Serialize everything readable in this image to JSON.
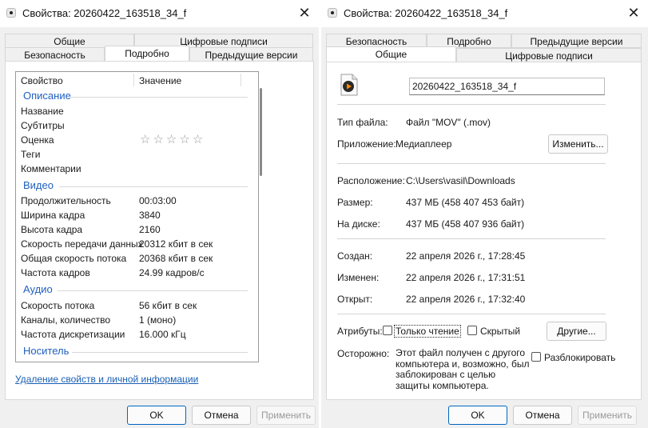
{
  "left": {
    "title": "Свойства: 20260422_163518_34_f",
    "tabs_row1": [
      "Общие",
      "Цифровые подписи"
    ],
    "tabs_row2": [
      "Безопасность",
      "Подробно",
      "Предыдущие версии"
    ],
    "active_tab": "Подробно",
    "headers": {
      "property": "Свойство",
      "value": "Значение"
    },
    "groups": {
      "description": "Описание",
      "video": "Видео",
      "audio": "Аудио",
      "media": "Носитель"
    },
    "description_rows": [
      {
        "name": "Название",
        "value": ""
      },
      {
        "name": "Субтитры",
        "value": ""
      },
      {
        "name": "Оценка",
        "value": ""
      },
      {
        "name": "Теги",
        "value": ""
      },
      {
        "name": "Комментарии",
        "value": ""
      }
    ],
    "rating_stars": "☆☆☆☆☆",
    "rating_value": 0,
    "video_rows": [
      {
        "name": "Продолжительность",
        "value": "00:03:00"
      },
      {
        "name": "Ширина кадра",
        "value": "3840"
      },
      {
        "name": "Высота кадра",
        "value": "2160"
      },
      {
        "name": "Скорость передачи данных",
        "value": "20312 кбит в сек"
      },
      {
        "name": "Общая скорость потока",
        "value": "20368 кбит в сек"
      },
      {
        "name": "Частота кадров",
        "value": "24.99 кадров/с"
      }
    ],
    "audio_rows": [
      {
        "name": "Скорость потока",
        "value": "56 кбит в сек"
      },
      {
        "name": "Каналы, количество",
        "value": "1 (моно)"
      },
      {
        "name": "Частота дискретизации",
        "value": "16.000 кГц"
      }
    ],
    "remove_link": "Удаление свойств и личной информации",
    "buttons": {
      "ok": "OK",
      "cancel": "Отмена",
      "apply": "Применить"
    }
  },
  "right": {
    "title": "Свойства: 20260422_163518_34_f",
    "tabs_row1": [
      "Безопасность",
      "Подробно",
      "Предыдущие версии"
    ],
    "tabs_row2": [
      "Общие",
      "Цифровые подписи"
    ],
    "active_tab": "Общие",
    "filename": "20260422_163518_34_f",
    "file_type_label": "Тип файла:",
    "file_type_value": "Файл \"MOV\" (.mov)",
    "app_label": "Приложение:",
    "app_value": "Медиаплеер",
    "change_button": "Изменить...",
    "location_label": "Расположение:",
    "location_value": "C:\\Users\\vasil\\Downloads",
    "size_label": "Размер:",
    "size_value": "437 МБ (458 407 453 байт)",
    "disk_label": "На диске:",
    "disk_value": "437 МБ (458 407 936 байт)",
    "created_label": "Создан:",
    "created_value": "22 апреля 2026 г., 17:28:45",
    "modified_label": "Изменен:",
    "modified_value": "22 апреля 2026 г., 17:31:51",
    "opened_label": "Открыт:",
    "opened_value": "22 апреля 2026 г., 17:32:40",
    "attributes_label": "Атрибуты:",
    "readonly_label": "Только чтение",
    "readonly_checked": false,
    "hidden_label": "Скрытый",
    "hidden_checked": false,
    "other_button": "Другие...",
    "warning_label": "Осторожно:",
    "warning_text": "Этот файл получен с другого компьютера и, возможно, был заблокирован с целью защиты компьютера.",
    "unblock_label": "Разблокировать",
    "unblock_checked": false,
    "buttons": {
      "ok": "OK",
      "cancel": "Отмена",
      "apply": "Применить"
    }
  },
  "colors": {
    "accent": "#0067c0",
    "group_header": "#1f5fbf",
    "link": "#1a5fb4"
  }
}
